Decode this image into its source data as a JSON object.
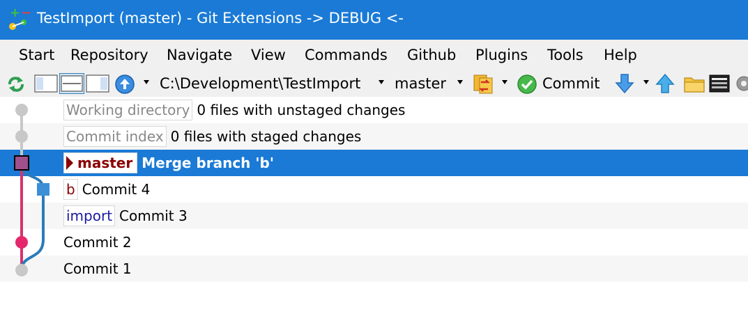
{
  "window": {
    "title": "TestImport (master) - Git Extensions -> DEBUG <-",
    "icon": "git-extensions-icon",
    "title_bar_color": "#1a7ad6"
  },
  "menu": [
    "Start",
    "Repository",
    "Navigate",
    "View",
    "Commands",
    "Github",
    "Plugins",
    "Tools",
    "Help"
  ],
  "toolbar": {
    "path": "C:\\Development\\TestImport",
    "branch": "master",
    "commit_label": "Commit",
    "icons": [
      "refresh-icon",
      "layout-left-icon",
      "layout-middle-icon",
      "layout-right-icon",
      "dashboard-icon",
      "branches-icon",
      "commit-check-icon",
      "pull-icon",
      "push-icon",
      "folder-icon",
      "console-icon",
      "settings-icon"
    ]
  },
  "rows": [
    {
      "tags": [
        {
          "text": "Working directory",
          "style": "gray"
        }
      ],
      "message": "0 files with unstaged changes"
    },
    {
      "tags": [
        {
          "text": "Commit index",
          "style": "gray"
        }
      ],
      "message": "0 files with staged changes"
    },
    {
      "tags": [
        {
          "text": "master",
          "style": "branch"
        }
      ],
      "message": "Merge branch 'b'",
      "selected": true
    },
    {
      "tags": [
        {
          "text": "b",
          "style": "red"
        }
      ],
      "message": "Commit 4"
    },
    {
      "tags": [
        {
          "text": "import",
          "style": "blue"
        }
      ],
      "message": "Commit 3"
    },
    {
      "tags": [],
      "message": "Commit 2"
    },
    {
      "tags": [],
      "message": "Commit 1"
    }
  ],
  "colors": {
    "selection": "#1a7ad6",
    "graph_pink": "#d6336c",
    "graph_blue": "#2b7bb9",
    "graph_gray": "#c8c8c8"
  }
}
